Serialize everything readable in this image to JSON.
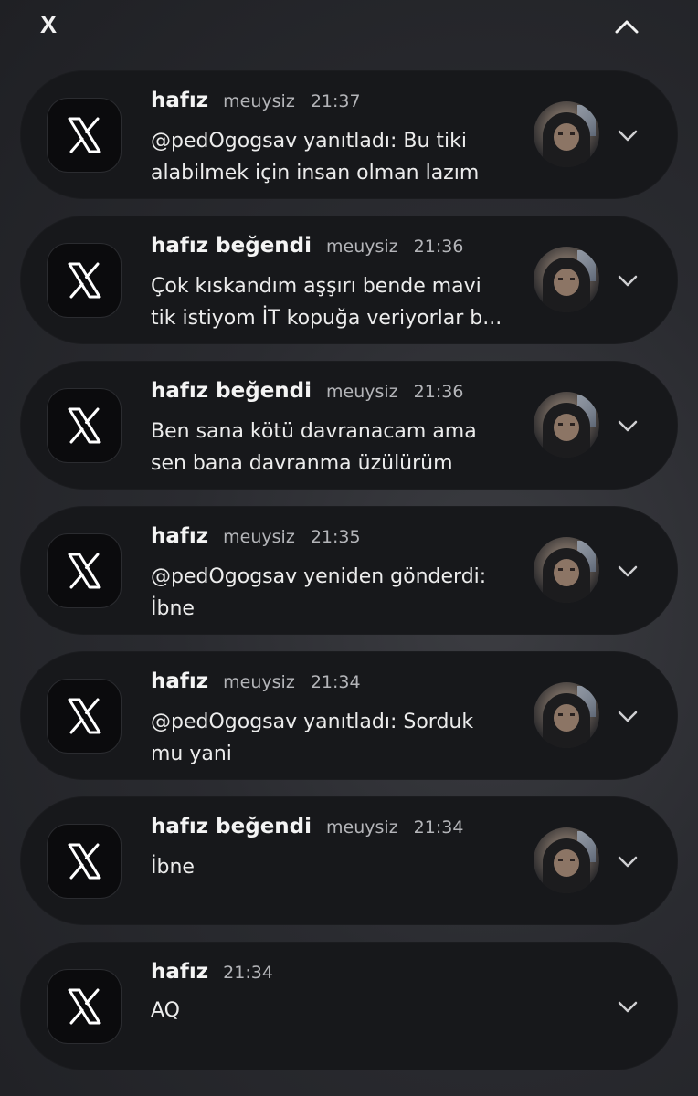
{
  "header": {
    "app_name": "X",
    "collapse_icon": "chevron-up-icon"
  },
  "notifications": [
    {
      "sender": "hafız",
      "account": "meuysiz",
      "time": "21:37",
      "text": "@pedOgogsav yanıtladı: Bu tiki\nalabilmek için insan olman lazım",
      "app_icon": "x-logo-icon",
      "expand_icon": "chevron-down-icon"
    },
    {
      "sender": "hafız beğendi",
      "account": "meuysiz",
      "time": "21:36",
      "text": "Çok kıskandım aşşırı bende mavi\ntik istiyom İT kopuğa veriyorlar b...",
      "app_icon": "x-logo-icon",
      "expand_icon": "chevron-down-icon"
    },
    {
      "sender": "hafız beğendi",
      "account": "meuysiz",
      "time": "21:36",
      "text": "Ben sana kötü davranacam ama\nsen bana davranma üzülürüm",
      "app_icon": "x-logo-icon",
      "expand_icon": "chevron-down-icon"
    },
    {
      "sender": "hafız",
      "account": "meuysiz",
      "time": "21:35",
      "text": "@pedOgogsav yeniden gönderdi:\nİbne",
      "app_icon": "x-logo-icon",
      "expand_icon": "chevron-down-icon"
    },
    {
      "sender": "hafız",
      "account": "meuysiz",
      "time": "21:34",
      "text": "@pedOgogsav yanıtladı: Sorduk\nmu yani",
      "app_icon": "x-logo-icon",
      "expand_icon": "chevron-down-icon"
    },
    {
      "sender": "hafız beğendi",
      "account": "meuysiz",
      "time": "21:34",
      "text": "İbne",
      "app_icon": "x-logo-icon",
      "expand_icon": "chevron-down-icon"
    },
    {
      "sender": "hafız",
      "time": "21:34",
      "text": "AQ",
      "app_icon": "x-logo-icon",
      "expand_icon": "chevron-down-icon"
    }
  ]
}
